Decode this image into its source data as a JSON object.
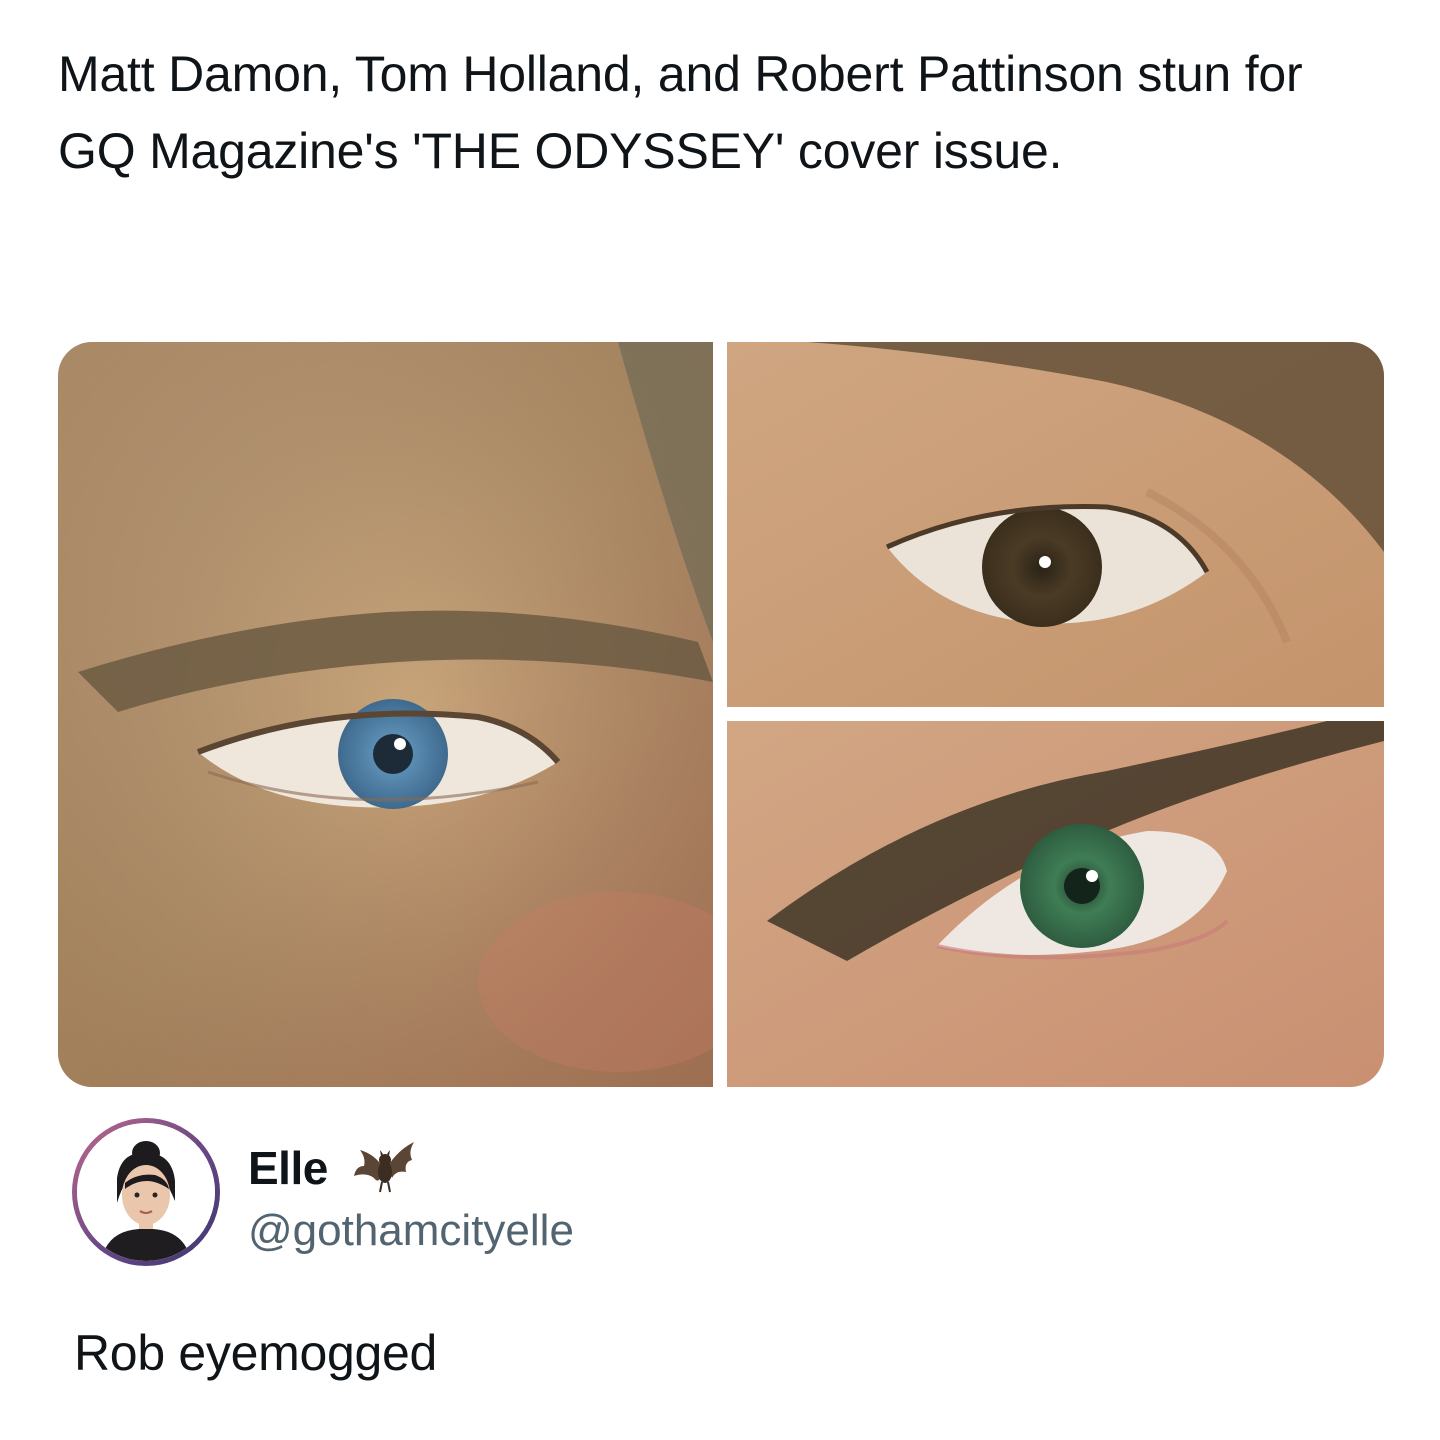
{
  "quoted_post": {
    "text": "Matt Damon, Tom Holland, and Robert Pattinson stun for GQ Magazine's 'THE ODYSSEY' cover issue.",
    "media": [
      {
        "subject": "blue-eye-photo"
      },
      {
        "subject": "brown-eye-photo"
      },
      {
        "subject": "green-eye-photo"
      }
    ]
  },
  "author": {
    "display_name": "Elle",
    "handle": "@gothamcityelle",
    "name_emoji": "bat-icon",
    "avatar": "illustrated-avatar"
  },
  "reply": {
    "text": "Rob eyemogged"
  },
  "colors": {
    "text_primary": "#0f1419",
    "text_secondary": "#536471",
    "background": "#ffffff"
  }
}
